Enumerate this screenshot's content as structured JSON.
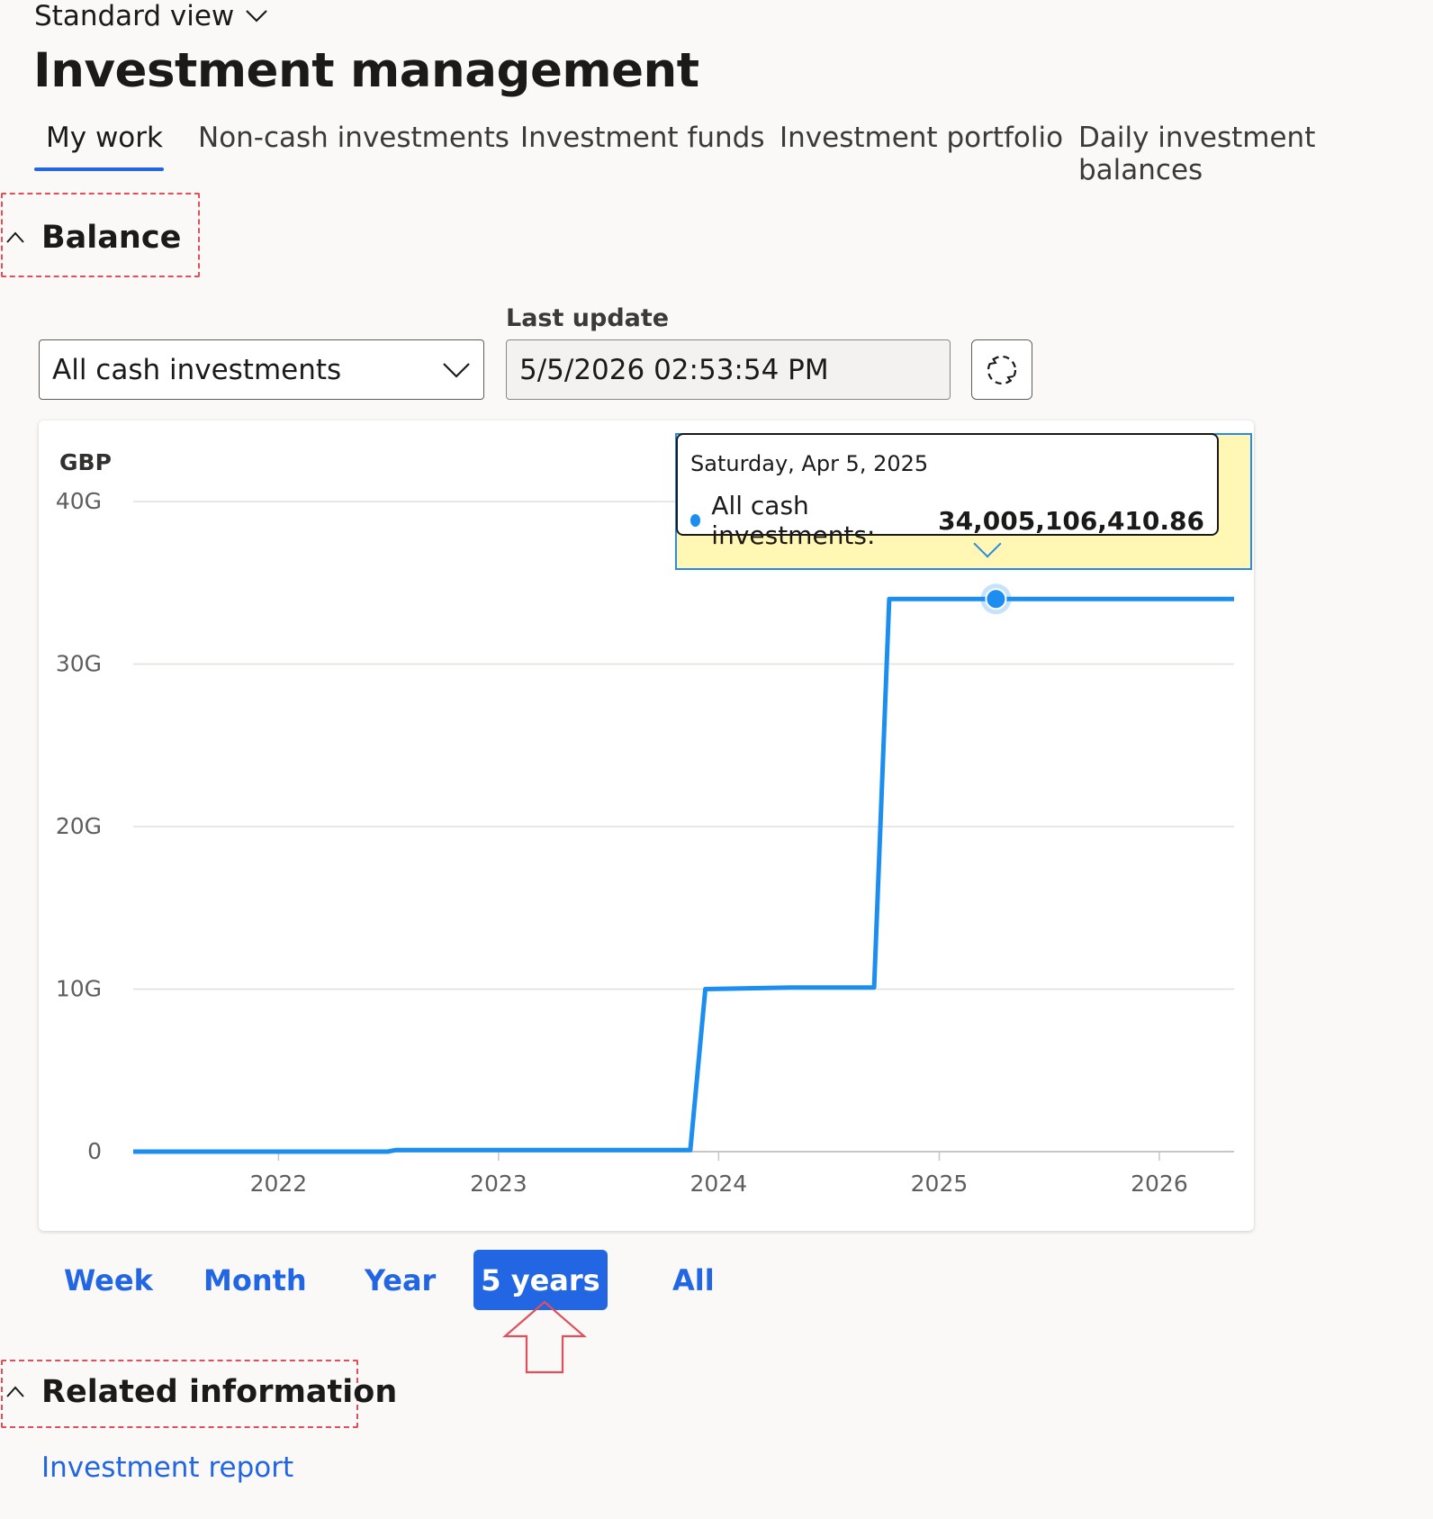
{
  "header": {
    "view_switch": "Standard view",
    "title": "Investment management"
  },
  "tabs": [
    {
      "label": "My work",
      "selected": true
    },
    {
      "label": "Non-cash investments"
    },
    {
      "label": "Investment funds"
    },
    {
      "label": "Investment portfolio"
    },
    {
      "label": "Daily investment balances"
    }
  ],
  "balance": {
    "section_title": "Balance",
    "select_value": "All cash investments",
    "last_update_label": "Last update",
    "last_update_value": "5/5/2026 02:53:54 PM"
  },
  "tooltip": {
    "date": "Saturday, Apr 5, 2025",
    "series": "All cash investments:",
    "value": "34,005,106,410.86"
  },
  "chart_data": {
    "type": "line",
    "ylabel": "GBP",
    "yticks": [
      "0",
      "10G",
      "20G",
      "30G",
      "40G"
    ],
    "ylim": [
      0,
      40000000000
    ],
    "xticks": [
      "2022",
      "2023",
      "2024",
      "2025",
      "2026"
    ],
    "xlim": [
      "2021-05-05",
      "2026-05-05"
    ],
    "grid": true,
    "accent_color": "#1c8ef0",
    "series": [
      {
        "name": "All cash investments",
        "points": [
          {
            "x": "2021-05-05",
            "y": 0
          },
          {
            "x": "2022-07-01",
            "y": 0
          },
          {
            "x": "2022-07-15",
            "y": 100000000
          },
          {
            "x": "2023-11-15",
            "y": 100000000
          },
          {
            "x": "2023-12-10",
            "y": 10000000000
          },
          {
            "x": "2024-05-01",
            "y": 10100000000
          },
          {
            "x": "2024-09-15",
            "y": 10100000000
          },
          {
            "x": "2024-10-10",
            "y": 34005106410.86
          },
          {
            "x": "2026-05-05",
            "y": 34005106410.86
          }
        ],
        "highlight": {
          "x": "2025-04-05",
          "y": 34005106410.86
        }
      }
    ]
  },
  "range_buttons": {
    "week": "Week",
    "month": "Month",
    "year": "Year",
    "five_years": "5 years",
    "all": "All",
    "selected": "5 years"
  },
  "related": {
    "section_title": "Related information",
    "link": "Investment report"
  }
}
